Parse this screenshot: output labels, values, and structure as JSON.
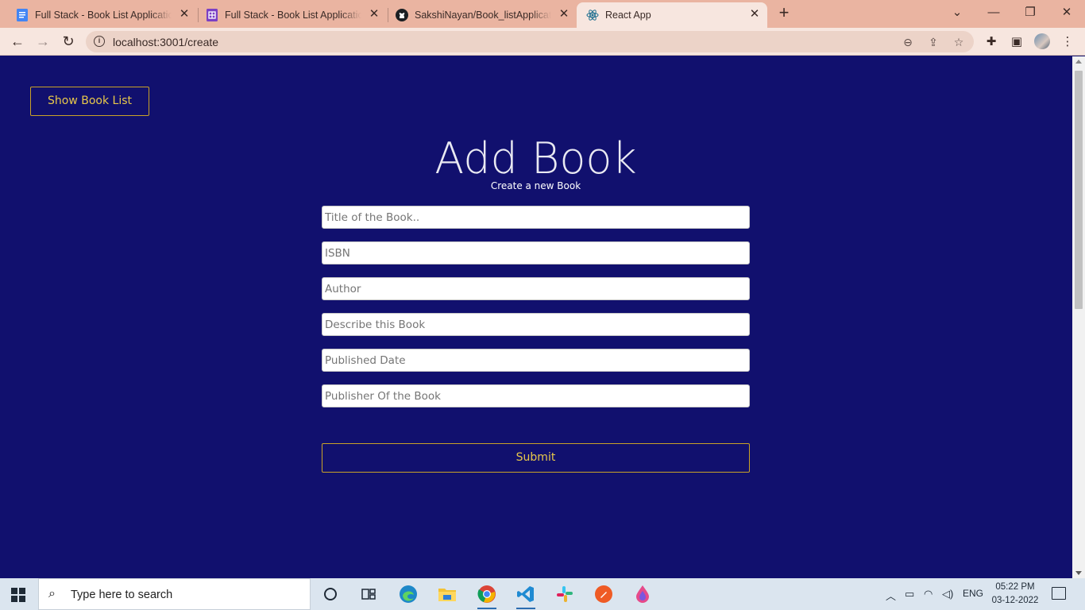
{
  "browser": {
    "tabs": [
      {
        "title": "Full Stack - Book List Application",
        "icon": "google-docs-icon",
        "active": false
      },
      {
        "title": "Full Stack - Book List Application",
        "icon": "google-sheets-icon",
        "active": false
      },
      {
        "title": "SakshiNayan/Book_listApplication",
        "icon": "github-icon",
        "active": false
      },
      {
        "title": "React App",
        "icon": "react-icon",
        "active": true
      }
    ],
    "url": "localhost:3001/create"
  },
  "page": {
    "show_list_label": "Show Book List",
    "heading": "Add Book",
    "subheading": "Create a new Book",
    "fields": {
      "title_placeholder": "Title of the Book..",
      "isbn_placeholder": "ISBN",
      "author_placeholder": "Author",
      "description_placeholder": "Describe this Book",
      "published_date_placeholder": "Published Date",
      "publisher_placeholder": "Publisher Of the Book"
    },
    "submit_label": "Submit"
  },
  "taskbar": {
    "search_placeholder": "Type here to search",
    "language": "ENG",
    "time": "05:22 PM",
    "date": "03-12-2022"
  },
  "colors": {
    "page_background": "#11106e",
    "button_border": "#c9a227",
    "button_text": "#e8c84a",
    "tab_strip": "#eab4a1"
  }
}
